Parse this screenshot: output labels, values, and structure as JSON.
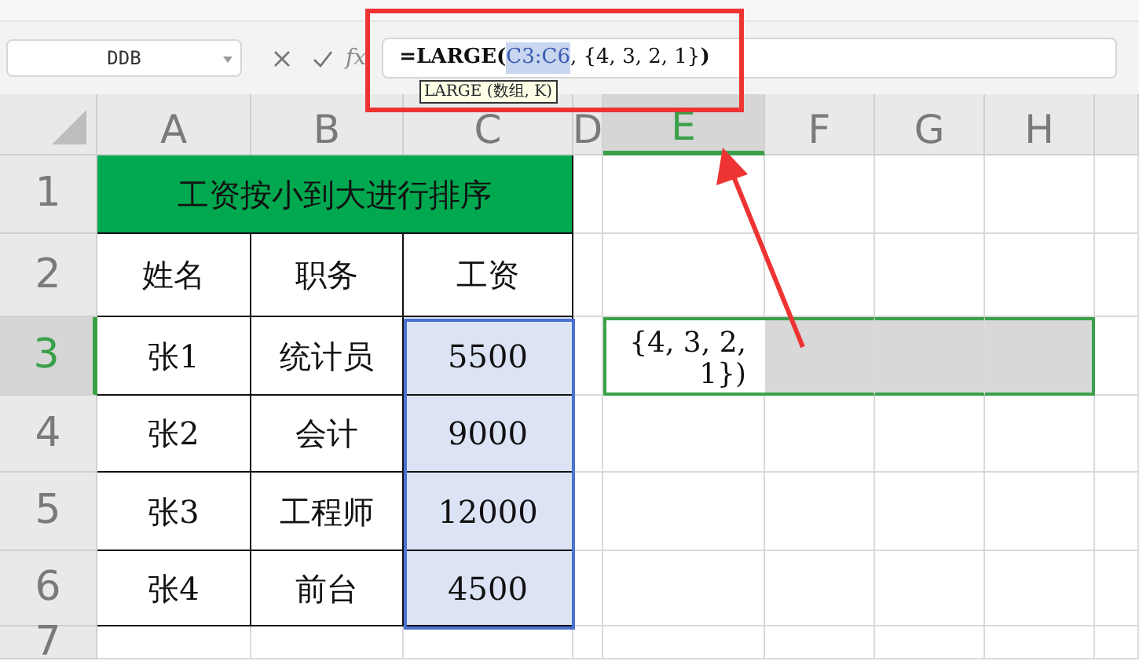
{
  "name_box": {
    "value": "DDB"
  },
  "formula_bar": {
    "function_label": "fx",
    "parts": [
      {
        "text": "=LARGE(",
        "kind": "bold"
      },
      {
        "text": "C3:C6",
        "kind": "ref"
      },
      {
        "text": ", {4, 3, 2, 1}",
        "kind": "plain"
      },
      {
        "text": ")",
        "kind": "bold"
      }
    ],
    "tooltip": "LARGE (数组, K)"
  },
  "column_headers": [
    {
      "label": "A",
      "selected": false
    },
    {
      "label": "B",
      "selected": false
    },
    {
      "label": "C",
      "selected": false
    },
    {
      "label": "D",
      "selected": false
    },
    {
      "label": "E",
      "selected": true
    },
    {
      "label": "F",
      "selected": false
    },
    {
      "label": "G",
      "selected": false
    },
    {
      "label": "H",
      "selected": false
    }
  ],
  "rows": [
    {
      "label": "1",
      "selected": false,
      "cells": [
        {
          "text": "工资按小到大进行排序",
          "kind": "title"
        }
      ]
    },
    {
      "label": "2",
      "selected": false,
      "cells": [
        {
          "text": "姓名",
          "kind": "data"
        },
        {
          "text": "职务",
          "kind": "data"
        },
        {
          "text": "工资",
          "kind": "data"
        }
      ]
    },
    {
      "label": "3",
      "selected": true,
      "cells": [
        {
          "text": "张1",
          "kind": "data"
        },
        {
          "text": "统计员",
          "kind": "data"
        },
        {
          "text": "5500",
          "kind": "range"
        },
        {
          "text": "{4, 3, 2, 1})",
          "kind": "editing"
        }
      ]
    },
    {
      "label": "4",
      "selected": false,
      "cells": [
        {
          "text": "张2",
          "kind": "data"
        },
        {
          "text": "会计",
          "kind": "data"
        },
        {
          "text": "9000",
          "kind": "range"
        }
      ]
    },
    {
      "label": "5",
      "selected": false,
      "cells": [
        {
          "text": "张3",
          "kind": "data"
        },
        {
          "text": "工程师",
          "kind": "data"
        },
        {
          "text": "12000",
          "kind": "range"
        }
      ]
    },
    {
      "label": "6",
      "selected": false,
      "cells": [
        {
          "text": "张4",
          "kind": "data"
        },
        {
          "text": "前台",
          "kind": "data"
        },
        {
          "text": "4500",
          "kind": "range"
        }
      ]
    },
    {
      "label": "7",
      "selected": false,
      "cells": []
    }
  ]
}
